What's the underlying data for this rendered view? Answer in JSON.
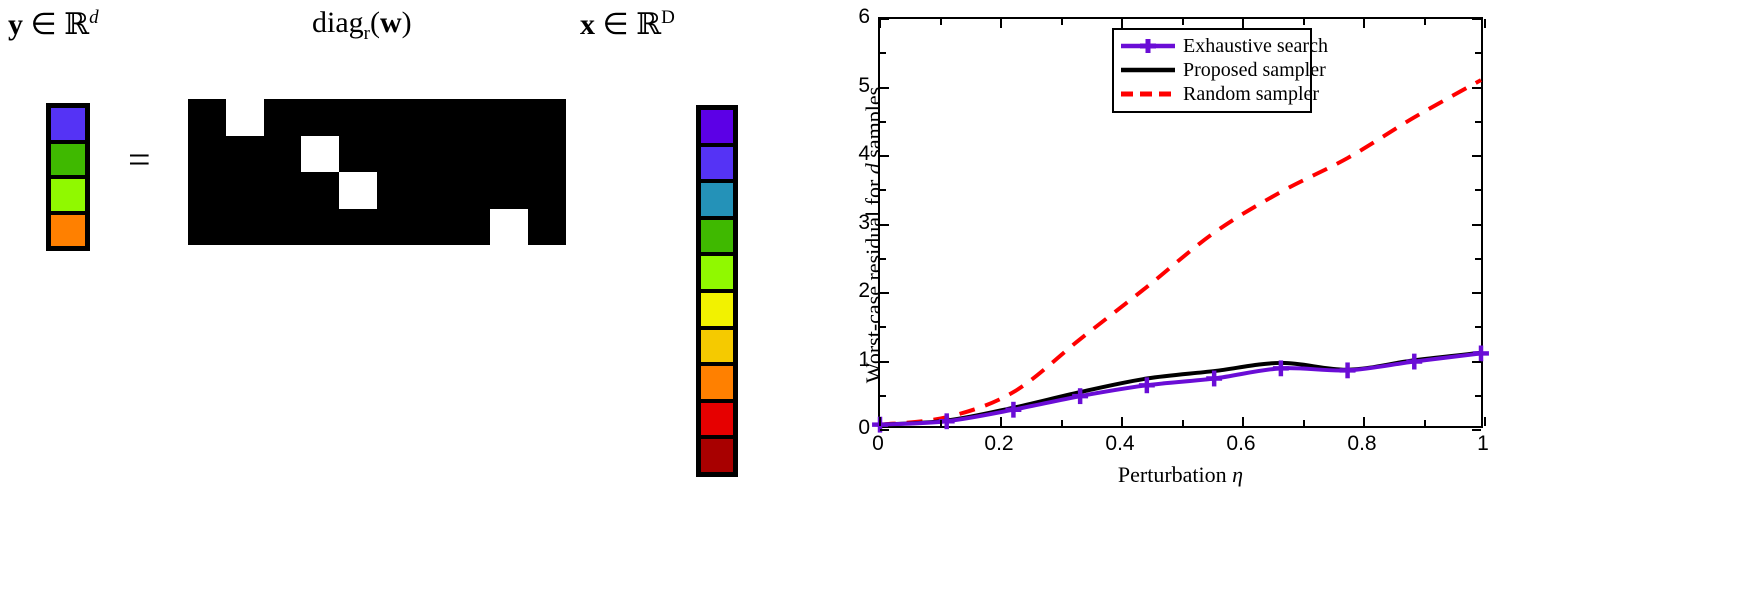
{
  "diagram": {
    "labels": {
      "y_vector": "y ∈ ℝ^d",
      "diag_operator": "diag_r(w)",
      "x_vector": "x ∈ ℝ^D",
      "equals": "="
    },
    "y_vector_colors": [
      "#5533f5",
      "#3fb900",
      "#90f900",
      "#ff8000"
    ],
    "x_vector_colors": [
      "#5c00e6",
      "#5533f5",
      "#2492b8",
      "#3fb900",
      "#90f900",
      "#f2f200",
      "#f5ca00",
      "#ff8000",
      "#e60000",
      "#a80000"
    ],
    "matrix": {
      "rows": 4,
      "cols": 10,
      "background_color": "#000000",
      "selected_color": "#ffffff",
      "selected_columns": [
        1,
        3,
        4,
        8
      ]
    }
  },
  "chart_data": {
    "type": "line",
    "title": "",
    "xlabel": "Perturbation η",
    "ylabel": "Worst-case residual for d samples",
    "xlim": [
      0,
      1
    ],
    "ylim": [
      0,
      6
    ],
    "xticks": [
      0,
      0.2,
      0.4,
      0.6,
      0.8,
      1
    ],
    "xtick_labels": [
      "0",
      "0.2",
      "0.4",
      "0.6",
      "0.8",
      "1"
    ],
    "yticks": [
      0,
      1,
      2,
      3,
      4,
      5,
      6
    ],
    "ytick_labels": [
      "0",
      "1",
      "2",
      "3",
      "4",
      "5",
      "6"
    ],
    "grid": false,
    "legend_position": "top-center",
    "series": [
      {
        "name": "Exhaustive search",
        "color": "#6a0dd6",
        "style": "solid-with-plus-markers",
        "x": [
          0,
          0.111,
          0.222,
          0.333,
          0.444,
          0.556,
          0.667,
          0.778,
          0.889,
          1.0
        ],
        "y": [
          0.02,
          0.07,
          0.24,
          0.44,
          0.6,
          0.7,
          0.85,
          0.82,
          0.95,
          1.07
        ]
      },
      {
        "name": "Proposed sampler",
        "color": "#000000",
        "style": "solid",
        "x": [
          0,
          0.111,
          0.222,
          0.333,
          0.444,
          0.556,
          0.667,
          0.778,
          0.889,
          1.0
        ],
        "y": [
          0.02,
          0.08,
          0.27,
          0.5,
          0.7,
          0.81,
          0.93,
          0.83,
          0.97,
          1.08
        ]
      },
      {
        "name": "Random sampler",
        "color": "#ff0000",
        "style": "dashed",
        "x": [
          0,
          0.111,
          0.222,
          0.333,
          0.444,
          0.556,
          0.667,
          0.778,
          0.889,
          1.0
        ],
        "y": [
          0.02,
          0.13,
          0.5,
          1.28,
          2.05,
          2.85,
          3.45,
          3.95,
          4.55,
          5.1
        ]
      }
    ]
  },
  "legend": {
    "items": [
      {
        "label": "Exhaustive search",
        "color": "#6a0dd6",
        "style": "solid-marker"
      },
      {
        "label": "Proposed sampler",
        "color": "#000000",
        "style": "solid"
      },
      {
        "label": "Random sampler",
        "color": "#ff0000",
        "style": "dashed"
      }
    ]
  }
}
